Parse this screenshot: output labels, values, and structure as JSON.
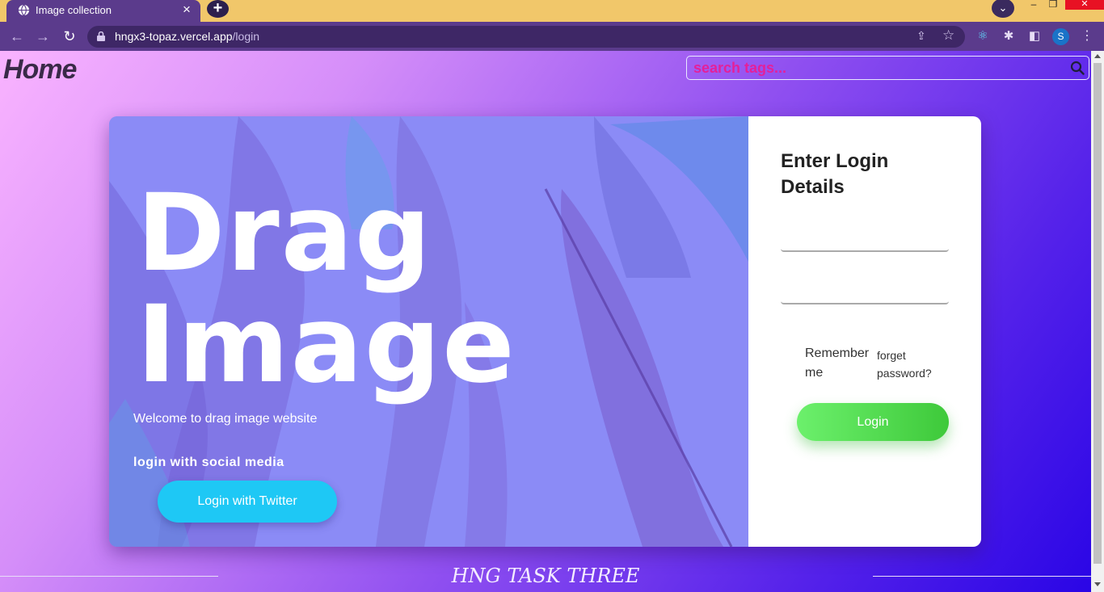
{
  "browser": {
    "tab_title": "Image collection",
    "tab_icon": "globe-icon",
    "url_host": "hngx3-topaz.vercel.app",
    "url_path": "/login",
    "profile_initial": "S"
  },
  "header": {
    "home_label": "Home",
    "search_placeholder": "search tags..."
  },
  "hero": {
    "title_line1": "Drag",
    "title_line2": "Image",
    "welcome": "Welcome to drag image website",
    "social_label": "login with social media",
    "twitter_button": "Login with Twitter"
  },
  "login": {
    "heading": "Enter Login Details",
    "username_value": "",
    "password_value": "",
    "remember_label": "Remember me",
    "forget_label": "forget password?",
    "button_label": "Login"
  },
  "footer": {
    "text": "HNG TASK THREE"
  },
  "colors": {
    "search_text": "#e4209a",
    "twitter_button": "#1ec8f5",
    "login_button": "#4fdc4c",
    "hero_overlay": "#8b8bf6"
  }
}
